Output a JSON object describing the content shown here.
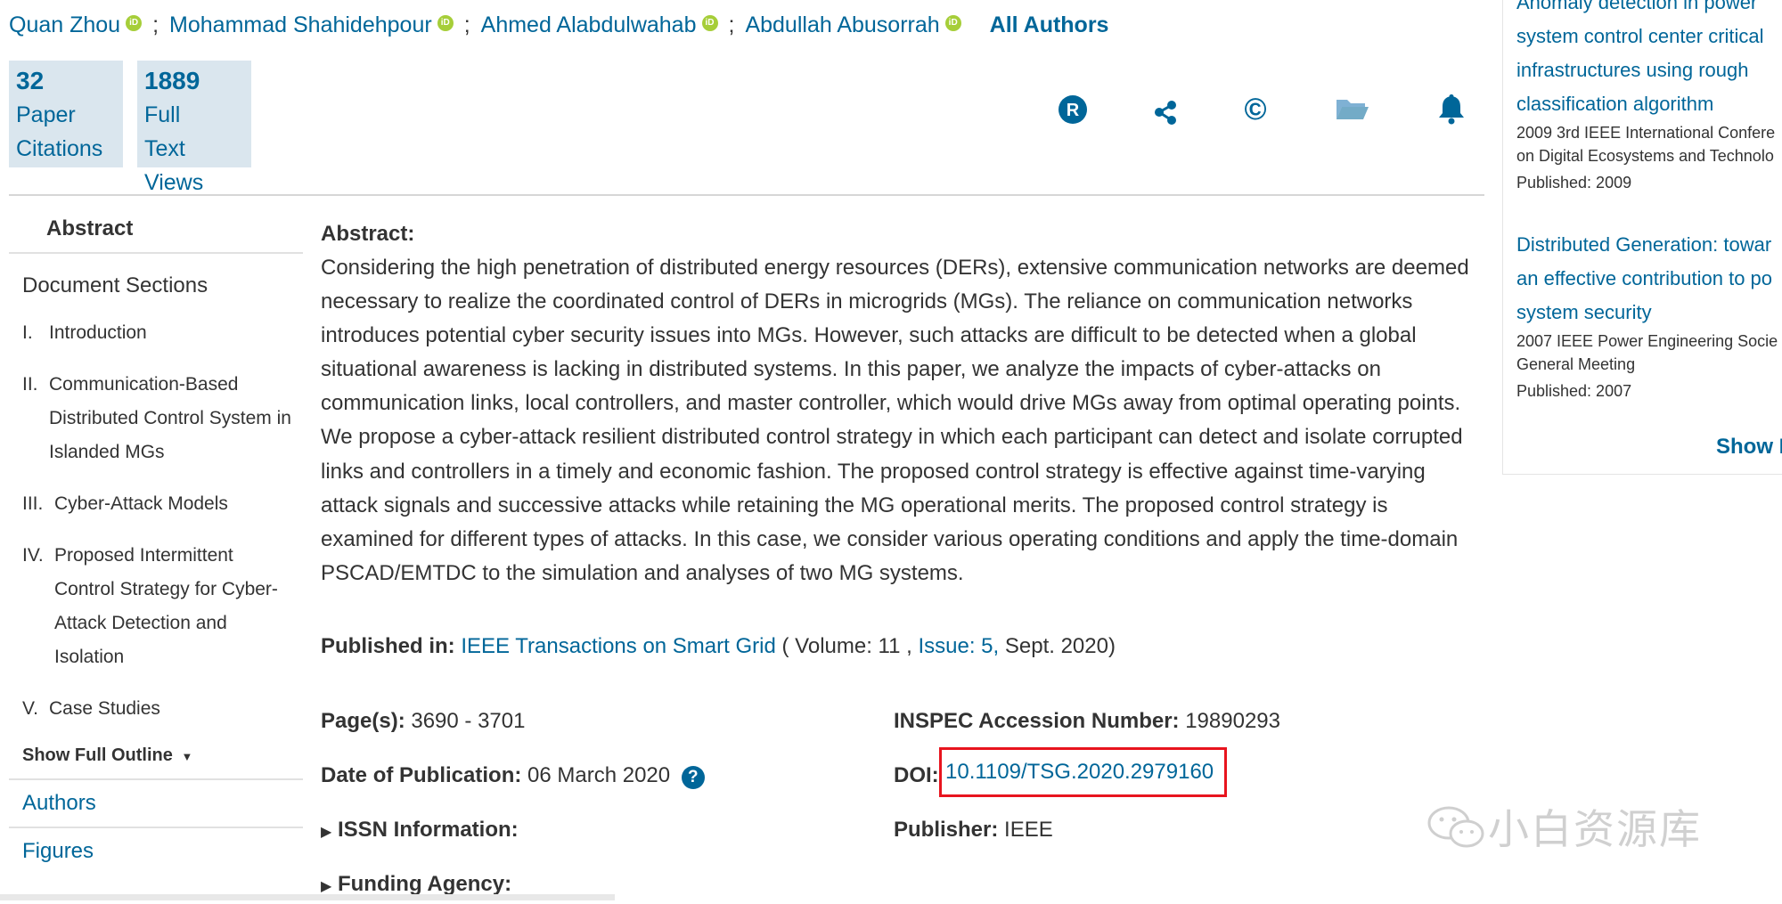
{
  "authors": {
    "list": [
      "Quan Zhou",
      "Mohammad Shahidehpour",
      "Ahmed Alabdulwahab",
      "Abdullah Abusorrah"
    ],
    "separator": ";",
    "orcid_label": "iD",
    "all_authors_label": "All Authors"
  },
  "metrics": {
    "citations": {
      "count": "32",
      "line1": "Paper",
      "line2": "Citations"
    },
    "views": {
      "count": "1889",
      "line1": "Full",
      "line2": "Text",
      "line3": "Views"
    }
  },
  "toolbar": {
    "icons": [
      "rights-icon",
      "share-icon",
      "copyright-icon",
      "folder-icon",
      "alert-bell-icon"
    ],
    "rights_glyph": "R",
    "copyright_glyph": "©"
  },
  "nav": {
    "abstract": "Abstract",
    "sections_heading": "Document Sections",
    "items": [
      {
        "num": "I.",
        "label": "Introduction"
      },
      {
        "num": "II.",
        "label": "Communication-Based Distributed Control System in Islanded MGs"
      },
      {
        "num": "III.",
        "label": "Cyber-Attack Models"
      },
      {
        "num": "IV.",
        "label": "Proposed Intermittent Control Strategy for Cyber-Attack Detection and Isolation"
      },
      {
        "num": "V.",
        "label": "Case Studies"
      }
    ],
    "show_full_outline": "Show Full Outline",
    "authors_link": "Authors",
    "figures_link": "Figures"
  },
  "abstract": {
    "title": "Abstract:",
    "text": "Considering the high penetration of distributed energy resources (DERs), extensive communication networks are deemed necessary to realize the coordinated control of DERs in microgrids (MGs). The reliance on communication networks introduces potential cyber security issues into MGs. However, such attacks are difficult to be detected when a global situational awareness is lacking in distributed systems. In this paper, we analyze the impacts of cyber-attacks on communication links, local controllers, and master controller, which would drive MGs away from optimal operating points. We propose a cyber-attack resilient distributed control strategy in which each participant can detect and isolate corrupted links and controllers in a timely and economic fashion. The proposed control strategy is effective against time-varying attack signals and successive attacks while retaining the MG operational merits. The proposed control strategy is examined for different types of attacks. In this case, we consider various operating conditions and apply the time-domain PSCAD/EMTDC to the simulation and analyses of two MG systems."
  },
  "published": {
    "label": "Published in:",
    "journal": "IEEE Transactions on Smart Grid",
    "volume_text": "( Volume: 11 ,",
    "issue": "Issue: 5,",
    "date": "Sept. 2020)"
  },
  "details": {
    "pages_label": "Page(s):",
    "pages_value": "3690 - 3701",
    "pubdate_label": "Date of Publication:",
    "pubdate_value": "06 March 2020",
    "help_glyph": "?",
    "issn_label": "ISSN Information:",
    "funding_label": "Funding Agency:",
    "inspec_label": "INSPEC Accession Number:",
    "inspec_value": "19890293",
    "doi_label": "DOI:",
    "doi_value": "10.1109/TSG.2020.2979160",
    "publisher_label": "Publisher:",
    "publisher_value": "IEEE"
  },
  "sidebar": {
    "item1": {
      "title_lines": [
        "Anomaly detection in power",
        "system control center critical",
        "infrastructures using rough",
        "classification algorithm"
      ],
      "venue_lines": [
        "2009 3rd IEEE International Confere",
        "on Digital Ecosystems and Technolo"
      ],
      "published": "Published: 2009"
    },
    "item2": {
      "title_lines": [
        "Distributed Generation: towar",
        "an effective contribution to po",
        "system security"
      ],
      "venue_lines": [
        "2007 IEEE Power Engineering Socie",
        "General Meeting"
      ],
      "published": "Published: 2007"
    },
    "show_more": "Show M"
  },
  "watermark": {
    "text": "小白资源库"
  },
  "colors": {
    "link": "#006699",
    "metric_bg": "#dae6ee",
    "highlight": "#e8141e",
    "orcid": "#a6ce39"
  }
}
